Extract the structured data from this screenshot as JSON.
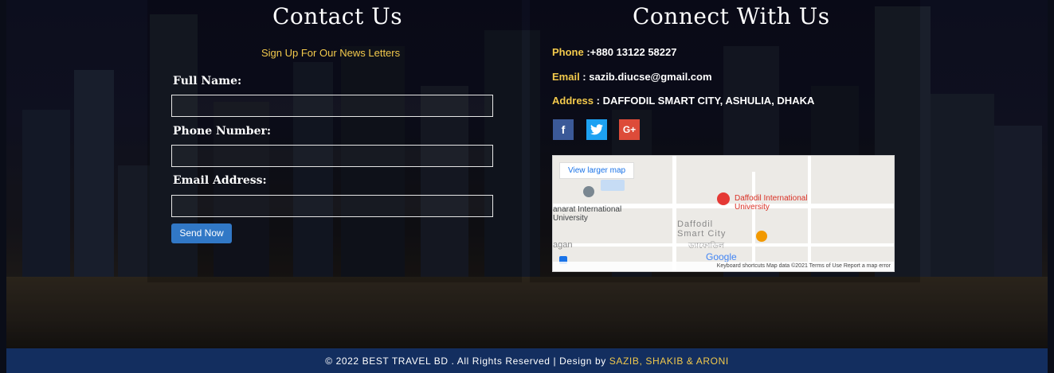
{
  "contact": {
    "title": "Contact Us",
    "subtitle": "Sign Up For Our News Letters",
    "full_name_label": "Full Name:",
    "phone_label": "Phone Number:",
    "email_label": "Email Address:",
    "full_name_value": "",
    "phone_value": "",
    "email_value": "",
    "send_label": "Send Now"
  },
  "connect": {
    "title": "Connect With Us",
    "phone_key": "Phone",
    "phone_value": " :+880 13122 58227",
    "email_key": "Email",
    "email_value": " : sazib.diucse@gmail.com",
    "address_key": "Address",
    "address_value": " : DAFFODIL SMART CITY, ASHULIA, DHAKA",
    "social": {
      "facebook": {
        "glyph": "f",
        "color": "#3b5998"
      },
      "twitter": {
        "glyph": "🐦",
        "color": "#1da1f2"
      },
      "googleplus": {
        "glyph": "G+",
        "color": "#dd4b39"
      }
    }
  },
  "map": {
    "view_larger": "View larger map",
    "place": "Daffodil International University",
    "left_place": "anarat International University",
    "area": "Daffodil Smart City",
    "area_bn": "ড্যাফোডিল",
    "left_text": "agan",
    "google": "Google",
    "footer": "Keyboard shortcuts   Map data ©2021   Terms of Use   Report a map error"
  },
  "footer": {
    "text": "© 2022 BEST TRAVEL BD . All Rights Reserved | Design by ",
    "authors": "SAZIB, SHAKIB & ARONI"
  }
}
